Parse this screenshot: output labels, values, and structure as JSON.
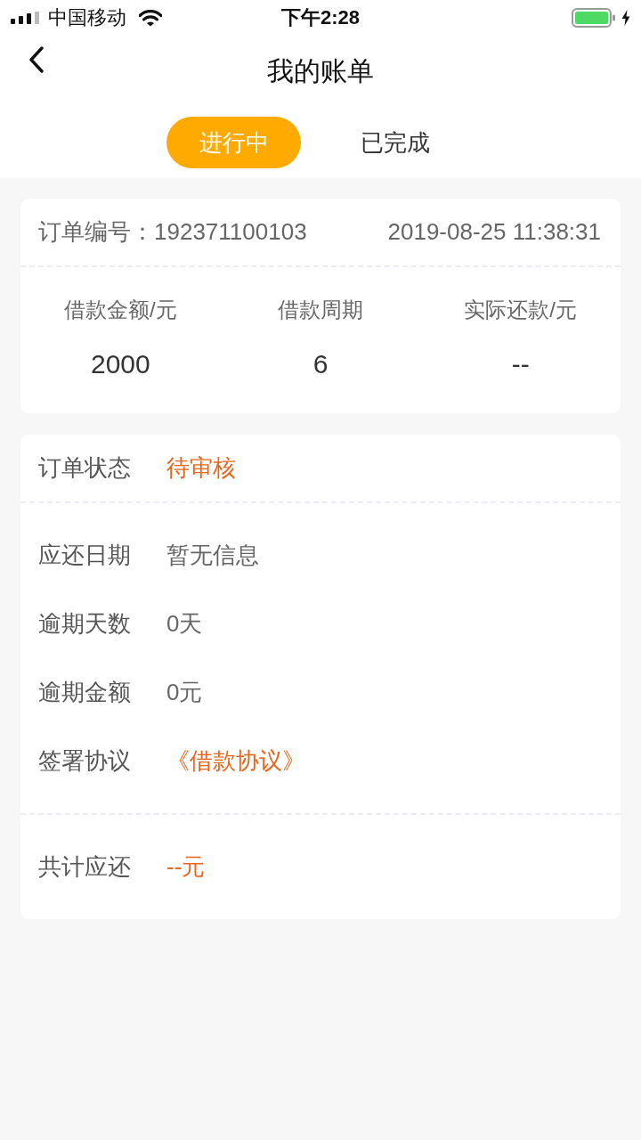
{
  "status_bar": {
    "carrier": "中国移动",
    "time": "下午2:28"
  },
  "header": {
    "title": "我的账单"
  },
  "tabs": [
    {
      "label": "进行中",
      "selected": true
    },
    {
      "label": "已完成",
      "selected": false
    }
  ],
  "summary": {
    "order": "订单编号：192371100103",
    "time": "2019-08-25 11:38:31",
    "columns": [
      {
        "label": "借款金额/元",
        "value": "2000"
      },
      {
        "label": "借款周期",
        "value": "6"
      },
      {
        "label": "实际还款/元",
        "value": "--"
      }
    ]
  },
  "details": {
    "sections": [
      {
        "rows": [
          {
            "label": "订单状态",
            "value": "待审核",
            "kind": "alert"
          }
        ]
      },
      {
        "rows": [
          {
            "label": "应还日期",
            "value": "暂无信息",
            "kind": "plain"
          },
          {
            "label": "逾期天数",
            "value": "0天",
            "kind": "plain"
          },
          {
            "label": "逾期金额",
            "value": "0元",
            "kind": "plain"
          },
          {
            "label": "签署协议",
            "value": "《借款协议》",
            "kind": "link"
          }
        ]
      },
      {
        "rows": [
          {
            "label": "共计应还",
            "value": "--元",
            "kind": "alert"
          }
        ]
      }
    ]
  }
}
